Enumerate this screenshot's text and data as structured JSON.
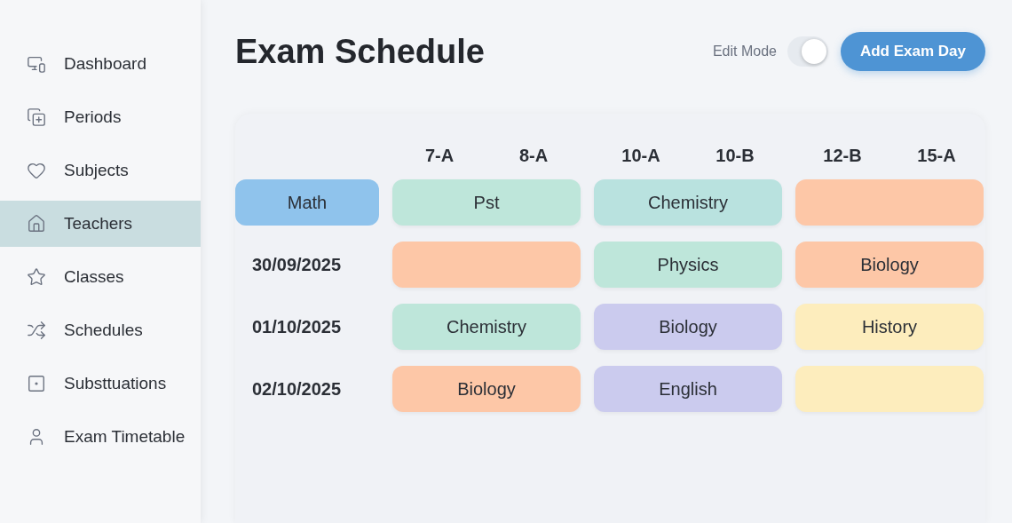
{
  "sidebar": {
    "items": [
      {
        "label": "Dashboard",
        "selected": false
      },
      {
        "label": "Periods",
        "selected": false
      },
      {
        "label": "Subjects",
        "selected": false
      },
      {
        "label": "Teachers",
        "selected": true
      },
      {
        "label": "Classes",
        "selected": false
      },
      {
        "label": "Schedules",
        "selected": false
      },
      {
        "label": "Substtuations",
        "selected": false
      },
      {
        "label": "Exam Timetable",
        "selected": false
      }
    ]
  },
  "header": {
    "title": "Exam Schedule",
    "edit_mode": {
      "label": "Edit Mode",
      "on": true
    },
    "add_button": "Add Exam Day"
  },
  "schedule": {
    "columns": [
      "7-A",
      "8-A",
      "10-A",
      "10-B",
      "12-B",
      "15-A"
    ],
    "rows": [
      {
        "kind": "subject",
        "label": "Math",
        "color": "#8fc3ec",
        "cells": [
          {
            "text": "Pst",
            "color": "#bee6da"
          },
          {
            "text": "Chemistry",
            "color": "#b9e2df"
          },
          {
            "color": "#fdc7a7"
          }
        ]
      },
      {
        "kind": "date",
        "label": "30/09/2025",
        "cells": [
          {
            "color": "#fdc7a7"
          },
          {
            "text": "Physics",
            "color": "#bee6da"
          },
          {
            "text": "Biology",
            "color": "#fdc7a7"
          }
        ]
      },
      {
        "kind": "date",
        "label": "01/10/2025",
        "cells": [
          {
            "text": "Chemistry",
            "color": "#bee6da"
          },
          {
            "text": "Biology",
            "color": "#cbcbee"
          },
          {
            "text": "History",
            "color": "#fdedbd"
          }
        ]
      },
      {
        "kind": "date",
        "label": "02/10/2025",
        "cells": [
          {
            "text": "Biology",
            "color": "#fdc7a7"
          },
          {
            "text": "English",
            "color": "#cbcbee"
          },
          {
            "color": "#fdedbd"
          }
        ]
      }
    ]
  }
}
